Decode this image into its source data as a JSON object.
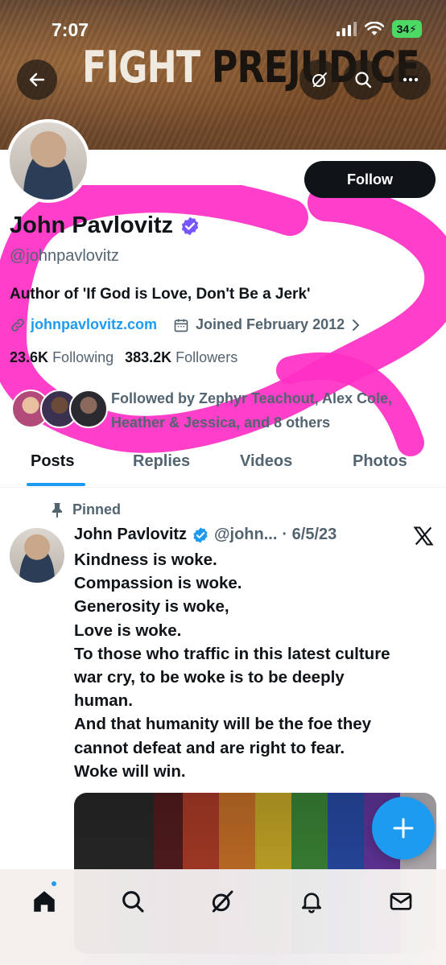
{
  "status_bar": {
    "time": "7:07",
    "battery": "34"
  },
  "banner": {
    "word1": "FIGHT",
    "word2": "PREJUDICE"
  },
  "header": {
    "back_icon": "arrow-left-icon",
    "grok_icon": "grok-icon",
    "search_icon": "search-icon",
    "more_icon": "more-icon"
  },
  "profile": {
    "follow_label": "Follow",
    "name": "John Pavlovitz",
    "handle": "@johnpavlovitz",
    "bio": "Author of 'If God is Love, Don't Be a Jerk'",
    "website": "johnpavlovitz.com",
    "joined": "Joined February 2012",
    "following_count": "23.6K",
    "following_label": "Following",
    "followers_count": "383.2K",
    "followers_label": "Followers",
    "followed_by": "Followed by Zephyr Teachout, Alex Cole, Heather & Jessica, and 8 others"
  },
  "tabs": [
    {
      "label": "Posts",
      "active": true
    },
    {
      "label": "Replies",
      "active": false
    },
    {
      "label": "Videos",
      "active": false
    },
    {
      "label": "Photos",
      "active": false
    }
  ],
  "post": {
    "pinned_label": "Pinned",
    "author": "John Pavlovitz",
    "handle": "@john...",
    "date": "· 6/5/23",
    "lines": [
      "Kindness is woke.",
      "Compassion is woke.",
      "Generosity is woke,",
      "Love is woke.",
      "To those who traffic in this latest culture",
      "war cry, to be woke is to be deeply",
      "human.",
      "And that humanity will be the foe they",
      "cannot defeat and are right to fear.",
      "Woke will win."
    ]
  },
  "colors": {
    "accent": "#1d9bf0",
    "verified": "#7856ff",
    "scribble": "#ff2fc4",
    "text": "#0f1419",
    "secondary": "#536471"
  },
  "bottom_nav": [
    "home-icon",
    "search-icon",
    "grok-icon",
    "notifications-icon",
    "messages-icon"
  ]
}
